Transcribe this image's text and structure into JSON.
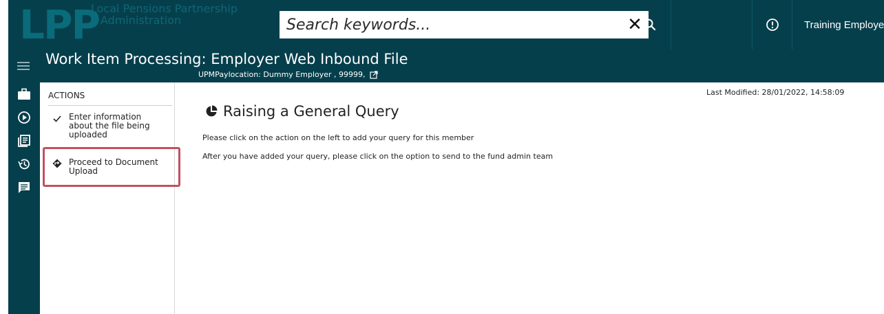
{
  "header": {
    "logo_mark": "LPP",
    "logo_line1": "Local Pensions Partnership",
    "logo_line2": "Administration",
    "search_placeholder": "Search keywords...",
    "search_clear_glyph": "✕",
    "user_name": "Training Employer"
  },
  "titlebar": {
    "title": "Work Item Processing: Employer Web Inbound File",
    "subtitle": "UPMPaylocation: Dummy Employer , 99999,"
  },
  "rail": {
    "icons": [
      "briefcase-icon",
      "play-circle-icon",
      "document-list-icon",
      "history-icon",
      "message-icon"
    ]
  },
  "actions": {
    "title": "ACTIONS",
    "items": [
      {
        "label": "Enter information about the file being uploaded",
        "icon": "check-icon",
        "completed": true
      },
      {
        "label": "Proceed to Document Upload",
        "icon": "diamond-arrow-icon",
        "completed": false
      }
    ]
  },
  "main": {
    "last_modified": "Last Modified: 28/01/2022, 14:58:09",
    "heading": "Raising a General Query",
    "paragraphs": [
      "Please click on the action on the left to add your query for this member",
      "After you have added your query, please click on the option to send to the fund admin team"
    ]
  },
  "colors": {
    "brand_dark": "#063f4c",
    "brand_logo": "#0a6b7a",
    "highlight": "#c2505f"
  }
}
